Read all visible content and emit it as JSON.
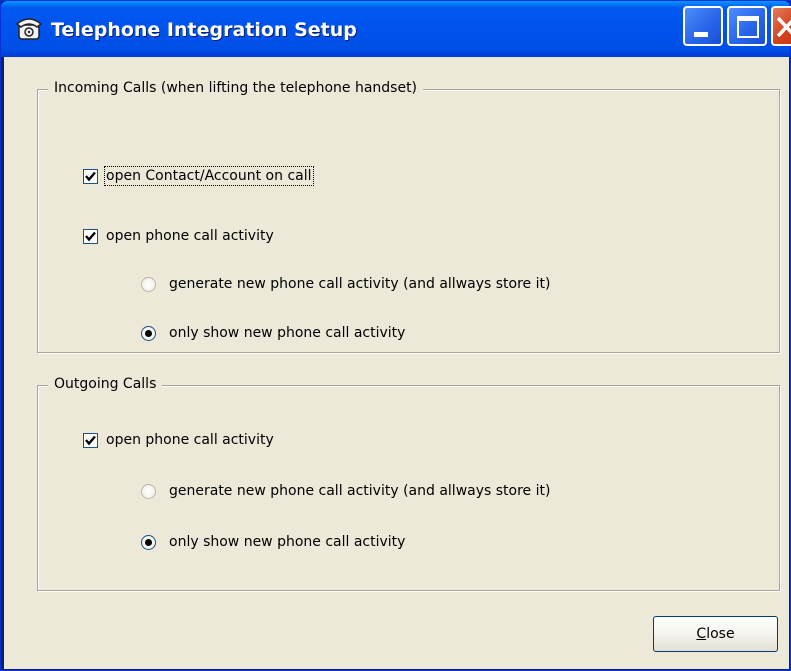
{
  "window": {
    "title": "Telephone Integration Setup",
    "icon": "telephone-icon",
    "buttons": {
      "minimize": "minimize-icon",
      "maximize": "maximize-icon",
      "close": "close-icon"
    }
  },
  "incoming": {
    "legend": "Incoming Calls (when lifting the telephone handset)",
    "open_contact": {
      "label": "open Contact/Account on call",
      "checked": true
    },
    "open_activity": {
      "label": "open phone call activity",
      "checked": true
    },
    "generate_new": {
      "label": "generate new phone call activity (and allways store it)",
      "checked": false
    },
    "only_show": {
      "label": "only show new phone call activity",
      "checked": true
    }
  },
  "outgoing": {
    "legend": "Outgoing Calls",
    "open_activity": {
      "label": "open phone call activity",
      "checked": true
    },
    "generate_new": {
      "label": "generate new phone call activity (and allways store it)",
      "checked": false
    },
    "only_show": {
      "label": "only show new phone call activity",
      "checked": true
    }
  },
  "footer": {
    "close_mnemonic": "C",
    "close_rest": "lose"
  },
  "colors": {
    "titlebar": "#0053ee",
    "dialog_bg": "#ece9d8",
    "close_button": "#d2441f"
  }
}
